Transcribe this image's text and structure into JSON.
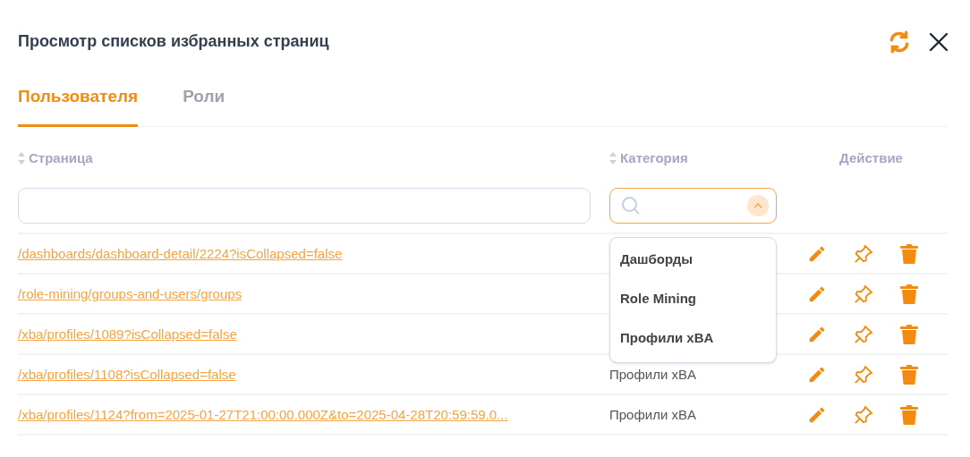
{
  "dialog": {
    "title": "Просмотр списков избранных страниц"
  },
  "tabs": [
    {
      "label": "Пользователя",
      "selected": true
    },
    {
      "label": "Роли",
      "selected": false
    }
  ],
  "table": {
    "columns": [
      {
        "label": "Страница",
        "sortable": true
      },
      {
        "label": "Категория",
        "sortable": true
      },
      {
        "label": "Действие",
        "sortable": false
      }
    ],
    "rows": [
      {
        "page": "/dashboards/dashboard-detail/2224?isCollapsed=false"
      },
      {
        "page": "/role-mining/groups-and-users/groups"
      },
      {
        "page": "/xba/profiles/1089?isCollapsed=false"
      },
      {
        "page": "/xba/profiles/1108?isCollapsed=false",
        "category": "Профили xBA"
      },
      {
        "page": "/xba/profiles/1124?from=2025-01-27T21:00:00.000Z&to=2025-04-28T20:59:59.0...",
        "category": "Профили xBA"
      }
    ]
  },
  "category_filter": {
    "expanded": true,
    "options": [
      "Дашборды",
      "Role Mining",
      "Профили xBA"
    ]
  }
}
